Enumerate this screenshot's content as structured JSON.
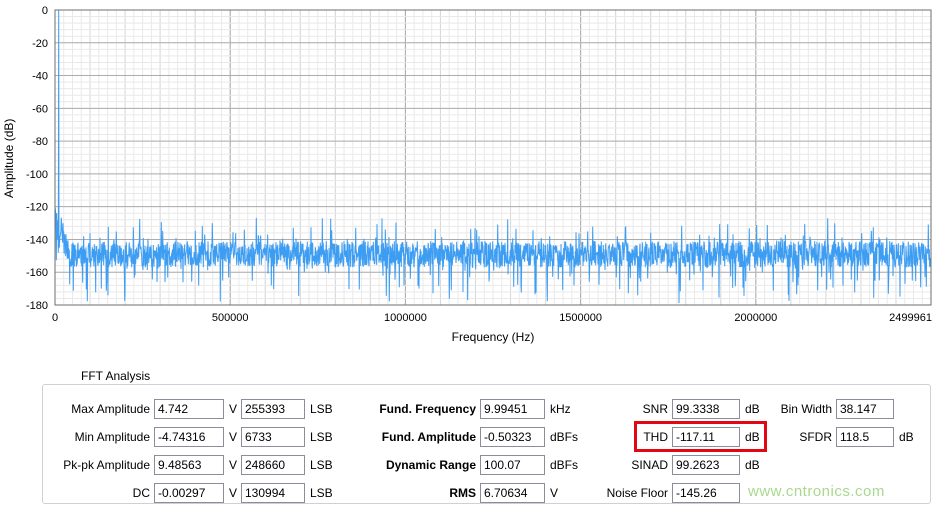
{
  "watermark": "www.cntronics.com",
  "chart_data": {
    "type": "line",
    "title": "",
    "xlabel": "Frequency (Hz)",
    "ylabel": "Amplitude (dB)",
    "xlim": [
      0,
      2499961
    ],
    "ylim": [
      -180,
      0
    ],
    "x_ticks": [
      "0",
      "500000",
      "1000000",
      "1500000",
      "2000000",
      "2499961"
    ],
    "y_ticks": [
      "0",
      "-20",
      "-40",
      "-60",
      "-80",
      "-100",
      "-120",
      "-140",
      "-160",
      "-180"
    ],
    "grid": true,
    "legend": "none",
    "line_color": "#3d9df3",
    "series": [
      {
        "name": "fft-spectrum",
        "description": "Dense random noise floor band between about -135 and -165 dB across 0 to 2.5 MHz with occasional spikes down to -180 dB, elevated noise up to about -120 dB below ~50 kHz, and a single fundamental tone spike reaching 0 dB near 10 kHz",
        "fundamental_frequency_hz": 9994.51,
        "fundamental_peak_db": 0,
        "noise_floor_db": -145.26
      }
    ]
  },
  "fft_analysis": {
    "title": "FFT Analysis",
    "units": {
      "V": "V",
      "LSB": "LSB"
    },
    "col1": [
      {
        "label": "Max Amplitude",
        "v": "4.742",
        "lsb": "255393"
      },
      {
        "label": "Min Amplitude",
        "v": "-4.74316",
        "lsb": "6733"
      },
      {
        "label": "Pk-pk Amplitude",
        "v": "9.48563",
        "lsb": "248660"
      },
      {
        "label": "DC",
        "v": "-0.00297",
        "lsb": "130994"
      }
    ],
    "col2": [
      {
        "label": "Fund. Frequency",
        "value": "9.99451",
        "unit": "kHz"
      },
      {
        "label": "Fund. Amplitude",
        "value": "-0.50323",
        "unit": "dBFs"
      },
      {
        "label": "Dynamic Range",
        "value": "100.07",
        "unit": "dBFs"
      },
      {
        "label": "RMS",
        "value": "6.70634",
        "unit": "V"
      }
    ],
    "col3": [
      {
        "label": "SNR",
        "value": "99.3338",
        "unit": "dB"
      },
      {
        "label": "THD",
        "value": "-117.11",
        "unit": "dB"
      },
      {
        "label": "SINAD",
        "value": "99.2623",
        "unit": "dB"
      },
      {
        "label": "Noise Floor",
        "value": "-145.26",
        "unit": ""
      }
    ],
    "col4": [
      {
        "label": "Bin Width",
        "value": "38.147",
        "unit": ""
      },
      {
        "label": "SFDR",
        "value": "118.5",
        "unit": "dB"
      }
    ],
    "highlight_color": "#e30613"
  }
}
